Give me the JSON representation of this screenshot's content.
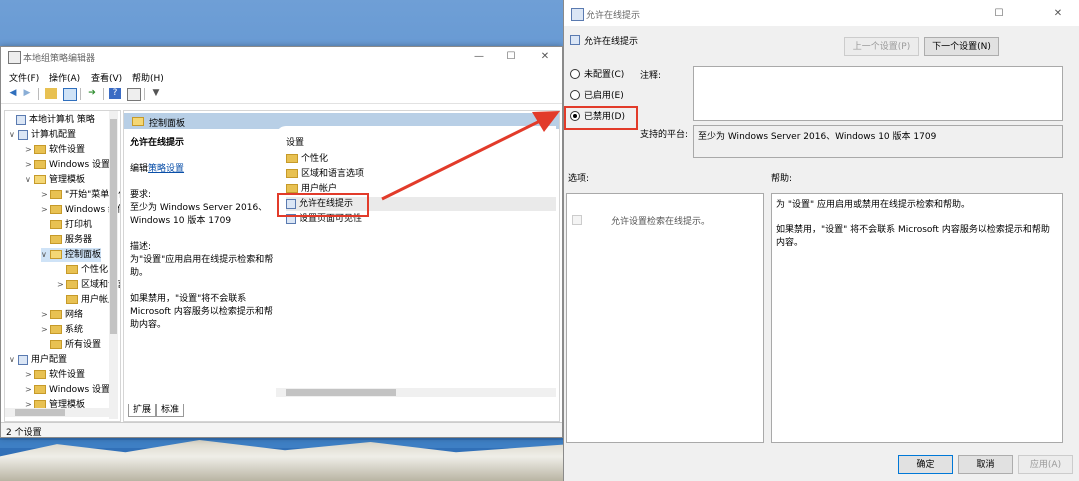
{
  "gpe": {
    "title": "本地组策略编辑器",
    "controls": {
      "minimize": "—",
      "maximize": "☐",
      "close": "✕"
    },
    "menu": [
      "文件(F)",
      "操作(A)",
      "查看(V)",
      "帮助(H)"
    ],
    "tree": [
      {
        "label": "本地计算机 策略",
        "level": 0,
        "twisty": ""
      },
      {
        "label": "计算机配置",
        "level": 1,
        "twisty": "∨"
      },
      {
        "label": "软件设置",
        "level": 2,
        "twisty": ">"
      },
      {
        "label": "Windows 设置",
        "level": 2,
        "twisty": ">"
      },
      {
        "label": "管理模板",
        "level": 2,
        "twisty": "∨"
      },
      {
        "label": "\"开始\"菜单和任务栏",
        "level": 3,
        "twisty": ">"
      },
      {
        "label": "Windows 组件",
        "level": 3,
        "twisty": ">"
      },
      {
        "label": "打印机",
        "level": 3,
        "twisty": ""
      },
      {
        "label": "服务器",
        "level": 3,
        "twisty": ""
      },
      {
        "label": "控制面板",
        "level": 3,
        "twisty": "∨",
        "selected": true
      },
      {
        "label": "个性化",
        "level": 4,
        "twisty": ""
      },
      {
        "label": "区域和语言选项",
        "level": 4,
        "twisty": ">"
      },
      {
        "label": "用户帐户",
        "level": 4,
        "twisty": ""
      },
      {
        "label": "网络",
        "level": 3,
        "twisty": ">"
      },
      {
        "label": "系统",
        "level": 3,
        "twisty": ">"
      },
      {
        "label": "所有设置",
        "level": 3,
        "twisty": ""
      },
      {
        "label": "用户配置",
        "level": 1,
        "twisty": "∨"
      },
      {
        "label": "软件设置",
        "level": 2,
        "twisty": ">"
      },
      {
        "label": "Windows 设置",
        "level": 2,
        "twisty": ">"
      },
      {
        "label": "管理模板",
        "level": 2,
        "twisty": ">"
      }
    ],
    "content_header": "控制面板",
    "desc": {
      "title": "允许在线提示",
      "edit_prefix": "编辑",
      "edit_link": "策略设置",
      "req_label": "要求:",
      "req_text": "至少为 Windows Server 2016、Windows 10 版本 1709",
      "desc_label": "描述:",
      "desc_text": "为\"设置\"应用启用在线提示检索和帮助。",
      "disabled_text": "如果禁用，\"设置\"将不会联系 Microsoft 内容服务以检索提示和帮助内容。"
    },
    "list_header": "设置",
    "list": [
      {
        "label": "个性化",
        "type": "folder"
      },
      {
        "label": "区域和语言选项",
        "type": "folder"
      },
      {
        "label": "用户帐户",
        "type": "folder"
      },
      {
        "label": "允许在线提示",
        "type": "policy",
        "highlight": true
      },
      {
        "label": "设置页面可见性",
        "type": "policy"
      }
    ],
    "tabs": [
      "扩展",
      "标准"
    ],
    "status": "2 个设置"
  },
  "dialog": {
    "title": "允许在线提示",
    "setting_name": "允许在线提示",
    "prev_button": "上一个设置(P)",
    "next_button": "下一个设置(N)",
    "radios": [
      {
        "label": "未配置(C)",
        "checked": false
      },
      {
        "label": "已启用(E)",
        "checked": false
      },
      {
        "label": "已禁用(D)",
        "checked": true
      }
    ],
    "comment_label": "注释:",
    "platform_label": "支持的平台:",
    "platform_value": "至少为 Windows Server 2016、Windows 10 版本 1709",
    "options_label": "选项:",
    "help_label": "帮助:",
    "option_checkbox": "允许设置检索在线提示。",
    "help_text": [
      "为 \"设置\" 应用启用或禁用在线提示检索和帮助。",
      "如果禁用，\"设置\" 将不会联系 Microsoft 内容服务以检索提示和帮助内容。"
    ],
    "ok_button": "确定",
    "cancel_button": "取消",
    "apply_button": "应用(A)"
  },
  "colors": {
    "annotation_red": "#e23b2a",
    "selection": "#cfe3f7",
    "header_bar": "#b8cfe6"
  }
}
